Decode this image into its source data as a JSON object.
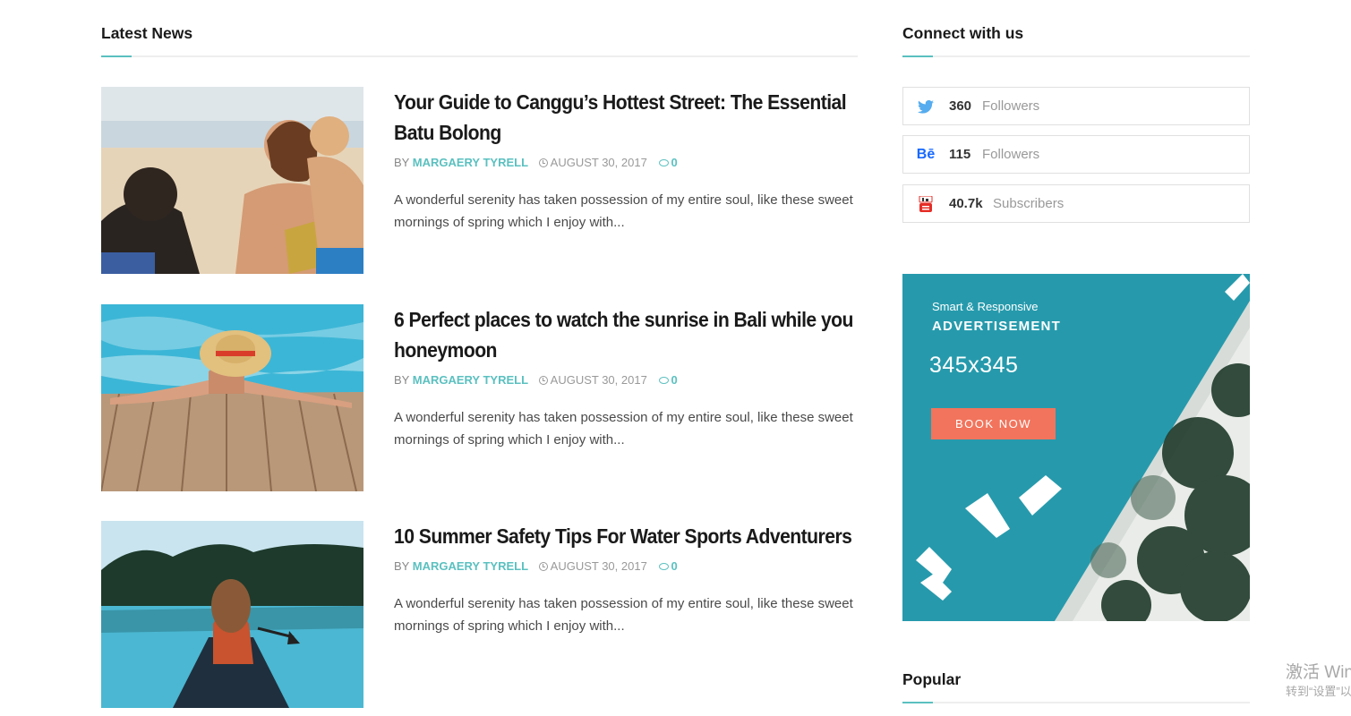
{
  "colors": {
    "accent": "#5bc0c0",
    "ad_button": "#f2745c",
    "ad_sea": "#2a9fb0"
  },
  "latest": {
    "heading": "Latest News",
    "posts": [
      {
        "title": "Your Guide to Canggu’s Hottest Street: The Essential Batu Bolong",
        "by": "BY",
        "author": "MARGAERY TYRELL",
        "date": "AUGUST 30, 2017",
        "comments": "0",
        "excerpt": "A wonderful serenity has taken possession of my entire soul, like these sweet mornings of spring which I enjoy with..."
      },
      {
        "title": "6 Perfect places to watch the sunrise in Bali while you honeymoon",
        "by": "BY",
        "author": "MARGAERY TYRELL",
        "date": "AUGUST 30, 2017",
        "comments": "0",
        "excerpt": "A wonderful serenity has taken possession of my entire soul, like these sweet mornings of spring which I enjoy with..."
      },
      {
        "title": "10 Summer Safety Tips For Water Sports Adventurers",
        "by": "BY",
        "author": "MARGAERY TYRELL",
        "date": "AUGUST 30, 2017",
        "comments": "0",
        "excerpt": "A wonderful serenity has taken possession of my entire soul, like these sweet mornings of spring which I enjoy with..."
      }
    ]
  },
  "connect": {
    "heading": "Connect with us",
    "items": [
      {
        "network": "twitter",
        "icon": "twitter-icon",
        "count": "360",
        "label": "Followers",
        "color": "#55acee"
      },
      {
        "network": "behance",
        "icon": "behance-icon",
        "icon_text": "Bē",
        "count": "115",
        "label": "Followers",
        "color": "#1769ff"
      },
      {
        "network": "youtube",
        "icon": "youtube-icon",
        "count": "40.7k",
        "label": "Subscribers",
        "color": "#e52d27"
      }
    ]
  },
  "ad": {
    "small": "Smart & Responsive",
    "big": "ADVERTISEMENT",
    "size": "345x345",
    "button": "BOOK NOW"
  },
  "popular": {
    "heading": "Popular"
  },
  "watermark": {
    "line1": "激活 Windows",
    "line2": "转到“设置”以激活 Windows。"
  }
}
